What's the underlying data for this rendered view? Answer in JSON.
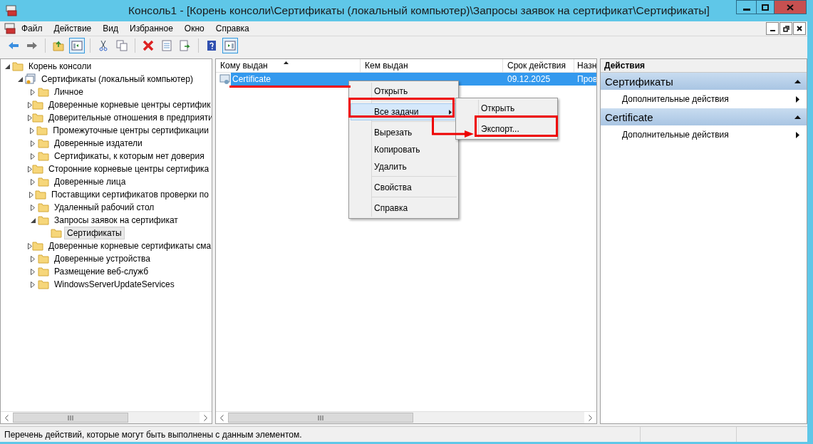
{
  "window": {
    "title": "Консоль1 - [Корень консоли\\Сертификаты (локальный компьютер)\\Запросы заявок на сертификат\\Сертификаты]"
  },
  "menu_bar": [
    "Файл",
    "Действие",
    "Вид",
    "Избранное",
    "Окно",
    "Справка"
  ],
  "tree": [
    {
      "label": "Корень консоли",
      "kind": "folder",
      "selected": false,
      "expanded": true,
      "children": [
        {
          "label": "Сертификаты (локальный компьютер)",
          "kind": "store",
          "selected": false,
          "expanded": true,
          "children": [
            {
              "label": "Личное",
              "kind": "folder",
              "selected": false,
              "expanded": false
            },
            {
              "label": "Доверенные корневые центры сертифик",
              "kind": "folder",
              "selected": false,
              "expanded": false
            },
            {
              "label": "Доверительные отношения в предприяти",
              "kind": "folder",
              "selected": false,
              "expanded": false
            },
            {
              "label": "Промежуточные центры сертификации",
              "kind": "folder",
              "selected": false,
              "expanded": false
            },
            {
              "label": "Доверенные издатели",
              "kind": "folder",
              "selected": false,
              "expanded": false
            },
            {
              "label": "Сертификаты, к которым нет доверия",
              "kind": "folder",
              "selected": false,
              "expanded": false
            },
            {
              "label": "Сторонние корневые центры сертифика",
              "kind": "folder",
              "selected": false,
              "expanded": false
            },
            {
              "label": "Доверенные лица",
              "kind": "folder",
              "selected": false,
              "expanded": false
            },
            {
              "label": "Поставщики сертификатов проверки по",
              "kind": "folder",
              "selected": false,
              "expanded": false
            },
            {
              "label": "Удаленный рабочий стол",
              "kind": "folder",
              "selected": false,
              "expanded": false
            },
            {
              "label": "Запросы заявок на сертификат",
              "kind": "folder",
              "selected": false,
              "expanded": true,
              "children": [
                {
                  "label": "Сертификаты",
                  "kind": "folder",
                  "selected": true
                }
              ]
            },
            {
              "label": "Доверенные корневые сертификаты сма",
              "kind": "folder",
              "selected": false,
              "expanded": false
            },
            {
              "label": "Доверенные устройства",
              "kind": "folder",
              "selected": false,
              "expanded": false
            },
            {
              "label": "Размещение веб-служб",
              "kind": "folder",
              "selected": false,
              "expanded": false
            },
            {
              "label": "WindowsServerUpdateServices",
              "kind": "folder",
              "selected": false,
              "expanded": false
            }
          ]
        }
      ]
    }
  ],
  "table": {
    "columns": [
      {
        "label": "Кому выдан",
        "sorted": true
      },
      {
        "label": "Кем выдан",
        "sorted": false
      },
      {
        "label": "Срок действия",
        "sorted": false
      },
      {
        "label": "Назн",
        "sorted": false
      }
    ],
    "rows": [
      {
        "issued_to": "Certificate",
        "expires": "09.12.2025",
        "column_4": "Пров",
        "selected": true
      }
    ]
  },
  "context_menu": {
    "items": [
      {
        "kind": "item",
        "label": "Открыть",
        "selected": false
      },
      {
        "kind": "separator"
      },
      {
        "kind": "item",
        "label": "Все задачи",
        "selected": true,
        "submenu": true
      },
      {
        "kind": "separator"
      },
      {
        "kind": "item",
        "label": "Вырезать",
        "selected": false
      },
      {
        "kind": "item",
        "label": "Копировать",
        "selected": false
      },
      {
        "kind": "item",
        "label": "Удалить",
        "selected": false
      },
      {
        "kind": "separator"
      },
      {
        "kind": "item",
        "label": "Свойства",
        "selected": false
      },
      {
        "kind": "separator"
      },
      {
        "kind": "item",
        "label": "Справка",
        "selected": false
      }
    ],
    "submenu": [
      {
        "kind": "item",
        "label": "Открыть",
        "selected": false
      },
      {
        "kind": "separator"
      },
      {
        "kind": "item",
        "label": "Экспорт...",
        "selected": false
      }
    ]
  },
  "actions": {
    "title": "Действия",
    "sections": [
      {
        "title": "Сертификаты",
        "expanded": true,
        "items": [
          "Дополнительные действия"
        ]
      },
      {
        "title": "Certificate",
        "expanded": true,
        "items": [
          "Дополнительные действия"
        ]
      }
    ]
  },
  "status_bar": "Перечень действий, которые могут быть выполнены с данным элементом."
}
